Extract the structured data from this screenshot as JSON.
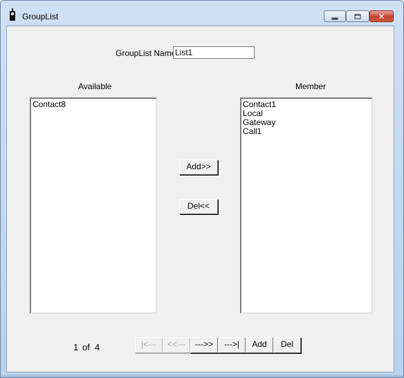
{
  "window": {
    "title": "GroupList",
    "icon": "mobile-phone-icon",
    "controls": {
      "minimize": "minimize-icon",
      "maximize": "maximize-icon",
      "close": "close-icon",
      "close_glyph": "✕"
    }
  },
  "form": {
    "name_label": "GroupList Name",
    "name_value": "List1"
  },
  "available": {
    "label": "Available",
    "items": [
      "Contact8"
    ]
  },
  "member": {
    "label": "Member",
    "items": [
      "Contact1",
      "Local",
      "Gateway",
      "Call1"
    ]
  },
  "actions": {
    "add_label": "Add>>",
    "del_label": "Del<<"
  },
  "pager": {
    "current": "1",
    "of_label": "of",
    "total": "4",
    "first_label": "|<---",
    "prev_label": "<<---",
    "next_label": "--->>",
    "last_label": "--->|",
    "add_label": "Add",
    "del_label": "Del"
  }
}
